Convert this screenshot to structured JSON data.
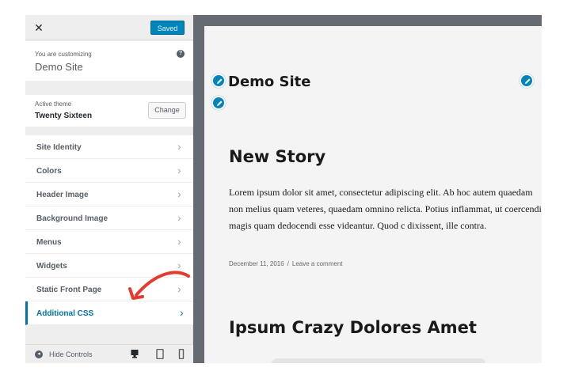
{
  "sidebar": {
    "close_icon": "close-icon",
    "saved_label": "Saved",
    "customizing_label": "You are customizing",
    "site_name": "Demo Site",
    "help_icon": "?",
    "theme_label": "Active theme",
    "theme_name": "Twenty Sixteen",
    "change_label": "Change",
    "items": [
      {
        "label": "Site Identity"
      },
      {
        "label": "Colors"
      },
      {
        "label": "Header Image"
      },
      {
        "label": "Background Image"
      },
      {
        "label": "Menus"
      },
      {
        "label": "Widgets"
      },
      {
        "label": "Static Front Page"
      },
      {
        "label": "Additional CSS",
        "active": true
      }
    ],
    "chevron": "›",
    "footer": {
      "hide_label": "Hide Controls",
      "hide_glyph": "◂",
      "devices": [
        "desktop-icon",
        "tablet-icon",
        "mobile-icon"
      ]
    }
  },
  "annotation": {
    "color": "#e63a2e",
    "target": "Additional CSS"
  },
  "preview": {
    "site_title": "Demo Site",
    "posts": [
      {
        "title": "New Story",
        "body": "Lorem ipsum dolor sit amet, consectetur adipiscing elit. Ab hoc autem quaedam non melius quam veteres, quaedam omnino relicta. Potius inflammat, ut coercendi magis quam dedocendi esse videantur. Quod c dixissent, ille contra.",
        "date": "December 11, 2016",
        "separator": "/",
        "comment_link": "Leave a comment"
      },
      {
        "title": "Ipsum Crazy Dolores Amet"
      }
    ]
  },
  "colors": {
    "accent": "#0085ba",
    "active": "#0073aa",
    "arrow": "#e63a2e"
  }
}
